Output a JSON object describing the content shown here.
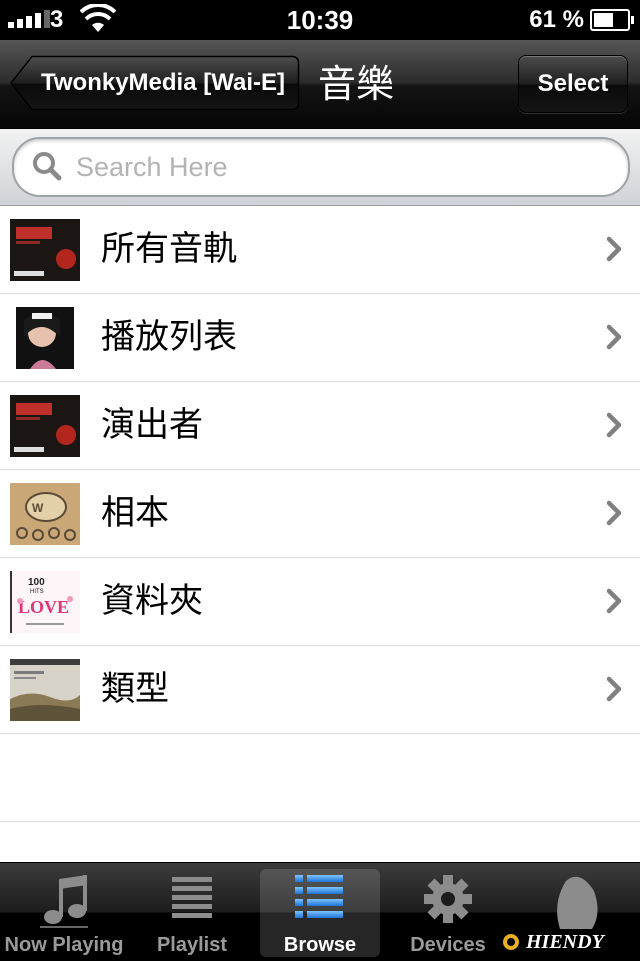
{
  "status_bar": {
    "carrier": "3",
    "time": "10:39",
    "battery_text": "61 %",
    "battery_level": 0.61,
    "signal_bars": 4
  },
  "nav": {
    "back_label": "TwonkyMedia [Wai-E]",
    "title": "音樂",
    "select_label": "Select"
  },
  "search": {
    "placeholder": "Search Here",
    "value": ""
  },
  "list": {
    "items": [
      {
        "label": "所有音軌",
        "thumb": "album-art-red"
      },
      {
        "label": "播放列表",
        "thumb": "album-art-portrait"
      },
      {
        "label": "演出者",
        "thumb": "album-art-red"
      },
      {
        "label": "相本",
        "thumb": "album-art-cardboard"
      },
      {
        "label": "資料夾",
        "thumb": "album-art-love"
      },
      {
        "label": "類型",
        "thumb": "album-art-landscape"
      }
    ]
  },
  "tabs": [
    {
      "label": "Now Playing",
      "icon": "music-note-icon",
      "active": false
    },
    {
      "label": "Playlist",
      "icon": "list-icon",
      "active": false
    },
    {
      "label": "Browse",
      "icon": "browse-list-icon",
      "active": true
    },
    {
      "label": "Devices",
      "icon": "gear-icon",
      "active": false
    },
    {
      "label": "",
      "icon": "more-icon",
      "active": false
    }
  ],
  "watermark": {
    "text": "HIENDY"
  },
  "colors": {
    "navbar": "#1a1a1a",
    "row_divider": "#dadada",
    "chevron": "#808080",
    "tab_active": "#3a7fd5"
  }
}
